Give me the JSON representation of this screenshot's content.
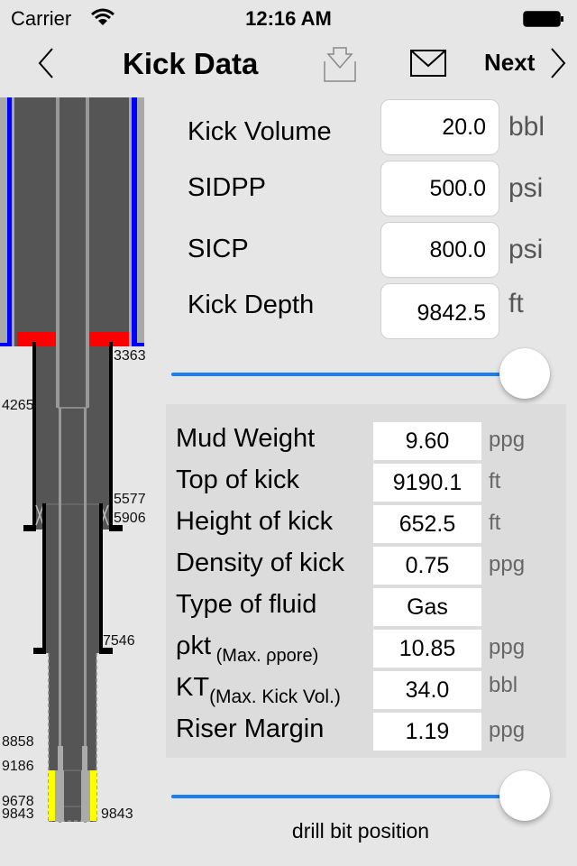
{
  "status_bar": {
    "carrier": "Carrier",
    "time": "12:16 AM"
  },
  "nav": {
    "title": "Kick Data",
    "next_label": "Next"
  },
  "colors": {
    "accent": "#1a7ff0",
    "riser_blue": "#0000ff",
    "bop_red": "#ff0000",
    "kick_yellow": "#ffff00",
    "pipe_gray": "#555555"
  },
  "wellbore": {
    "depth_labels": [
      {
        "value": "3363",
        "side": "right"
      },
      {
        "value": "4265",
        "side": "left"
      },
      {
        "value": "5577",
        "side": "right"
      },
      {
        "value": "5906",
        "side": "right"
      },
      {
        "value": "7546",
        "side": "right"
      },
      {
        "value": "8858",
        "side": "left"
      },
      {
        "value": "9186",
        "side": "left"
      },
      {
        "value": "9678",
        "side": "left"
      },
      {
        "value": "9843",
        "side": "left"
      },
      {
        "value": "9843",
        "side": "right"
      }
    ]
  },
  "inputs": [
    {
      "label": "Kick Volume",
      "value": "20.0",
      "unit": "bbl"
    },
    {
      "label": "SIDPP",
      "value": "500.0",
      "unit": "psi"
    },
    {
      "label": "SICP",
      "value": "800.0",
      "unit": "psi"
    },
    {
      "label": "Kick Depth",
      "value": "9842.5",
      "unit": "ft"
    }
  ],
  "kick_depth_slider": {
    "value_fraction": 1.0
  },
  "results": [
    {
      "label": "Mud Weight",
      "sub": "",
      "value": "9.60",
      "unit": "ppg"
    },
    {
      "label": "Top of kick",
      "sub": "",
      "value": "9190.1",
      "unit": "ft"
    },
    {
      "label": "Height of kick",
      "sub": "",
      "value": "652.5",
      "unit": "ft"
    },
    {
      "label": "Density of kick",
      "sub": "",
      "value": "0.75",
      "unit": "ppg"
    },
    {
      "label": "Type of fluid",
      "sub": "",
      "value": "Gas",
      "unit": ""
    },
    {
      "label": "ρkt",
      "sub": " (Max.  ρpore)",
      "value": "10.85",
      "unit": "ppg"
    },
    {
      "label": "KT",
      "sub": "(Max. Kick Vol.)",
      "value": "34.0",
      "unit": "bbl"
    },
    {
      "label": "Riser Margin",
      "sub": "",
      "value": "1.19",
      "unit": "ppg"
    }
  ],
  "bit_slider": {
    "value_fraction": 1.0,
    "caption": "drill bit position"
  }
}
